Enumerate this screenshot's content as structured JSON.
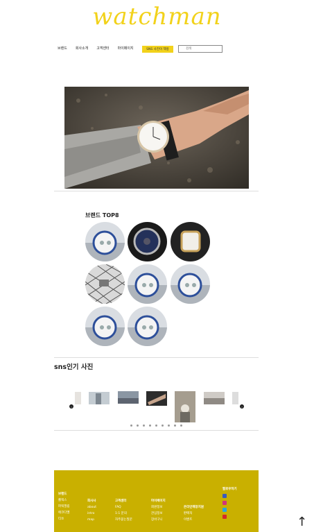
{
  "logo": "watchman",
  "nav": [
    "브랜드",
    "회사소개",
    "고객센터",
    "마이페이지"
  ],
  "member_button": "SNS 사진이 책방",
  "search": {
    "placeholder": "검색"
  },
  "brand_section": {
    "title": "브랜드 TOP8"
  },
  "sns_section": {
    "title": "sns인기 사진"
  },
  "footer": {
    "columns": [
      {
        "title": "브랜드",
        "items": [
          "롤렉스",
          "파텍필립",
          "에코다멜",
          "티쏘"
        ]
      },
      {
        "title": "회사사",
        "items": [
          "about",
          "intro",
          "map"
        ]
      },
      {
        "title": "고객센터",
        "items": [
          "FAQ",
          "1:1 문의",
          "자주묻는질문"
        ]
      },
      {
        "title": "마이페이지",
        "items": [
          "회원정보",
          "관심정보",
          "장바구니"
        ]
      },
      {
        "title": "온라인매장지원",
        "items": [
          "판매처",
          "이벤트"
        ]
      }
    ],
    "follow": "팔로우하기"
  },
  "colors": {
    "accent": "#f2d21b",
    "footer": "#c9b000"
  }
}
